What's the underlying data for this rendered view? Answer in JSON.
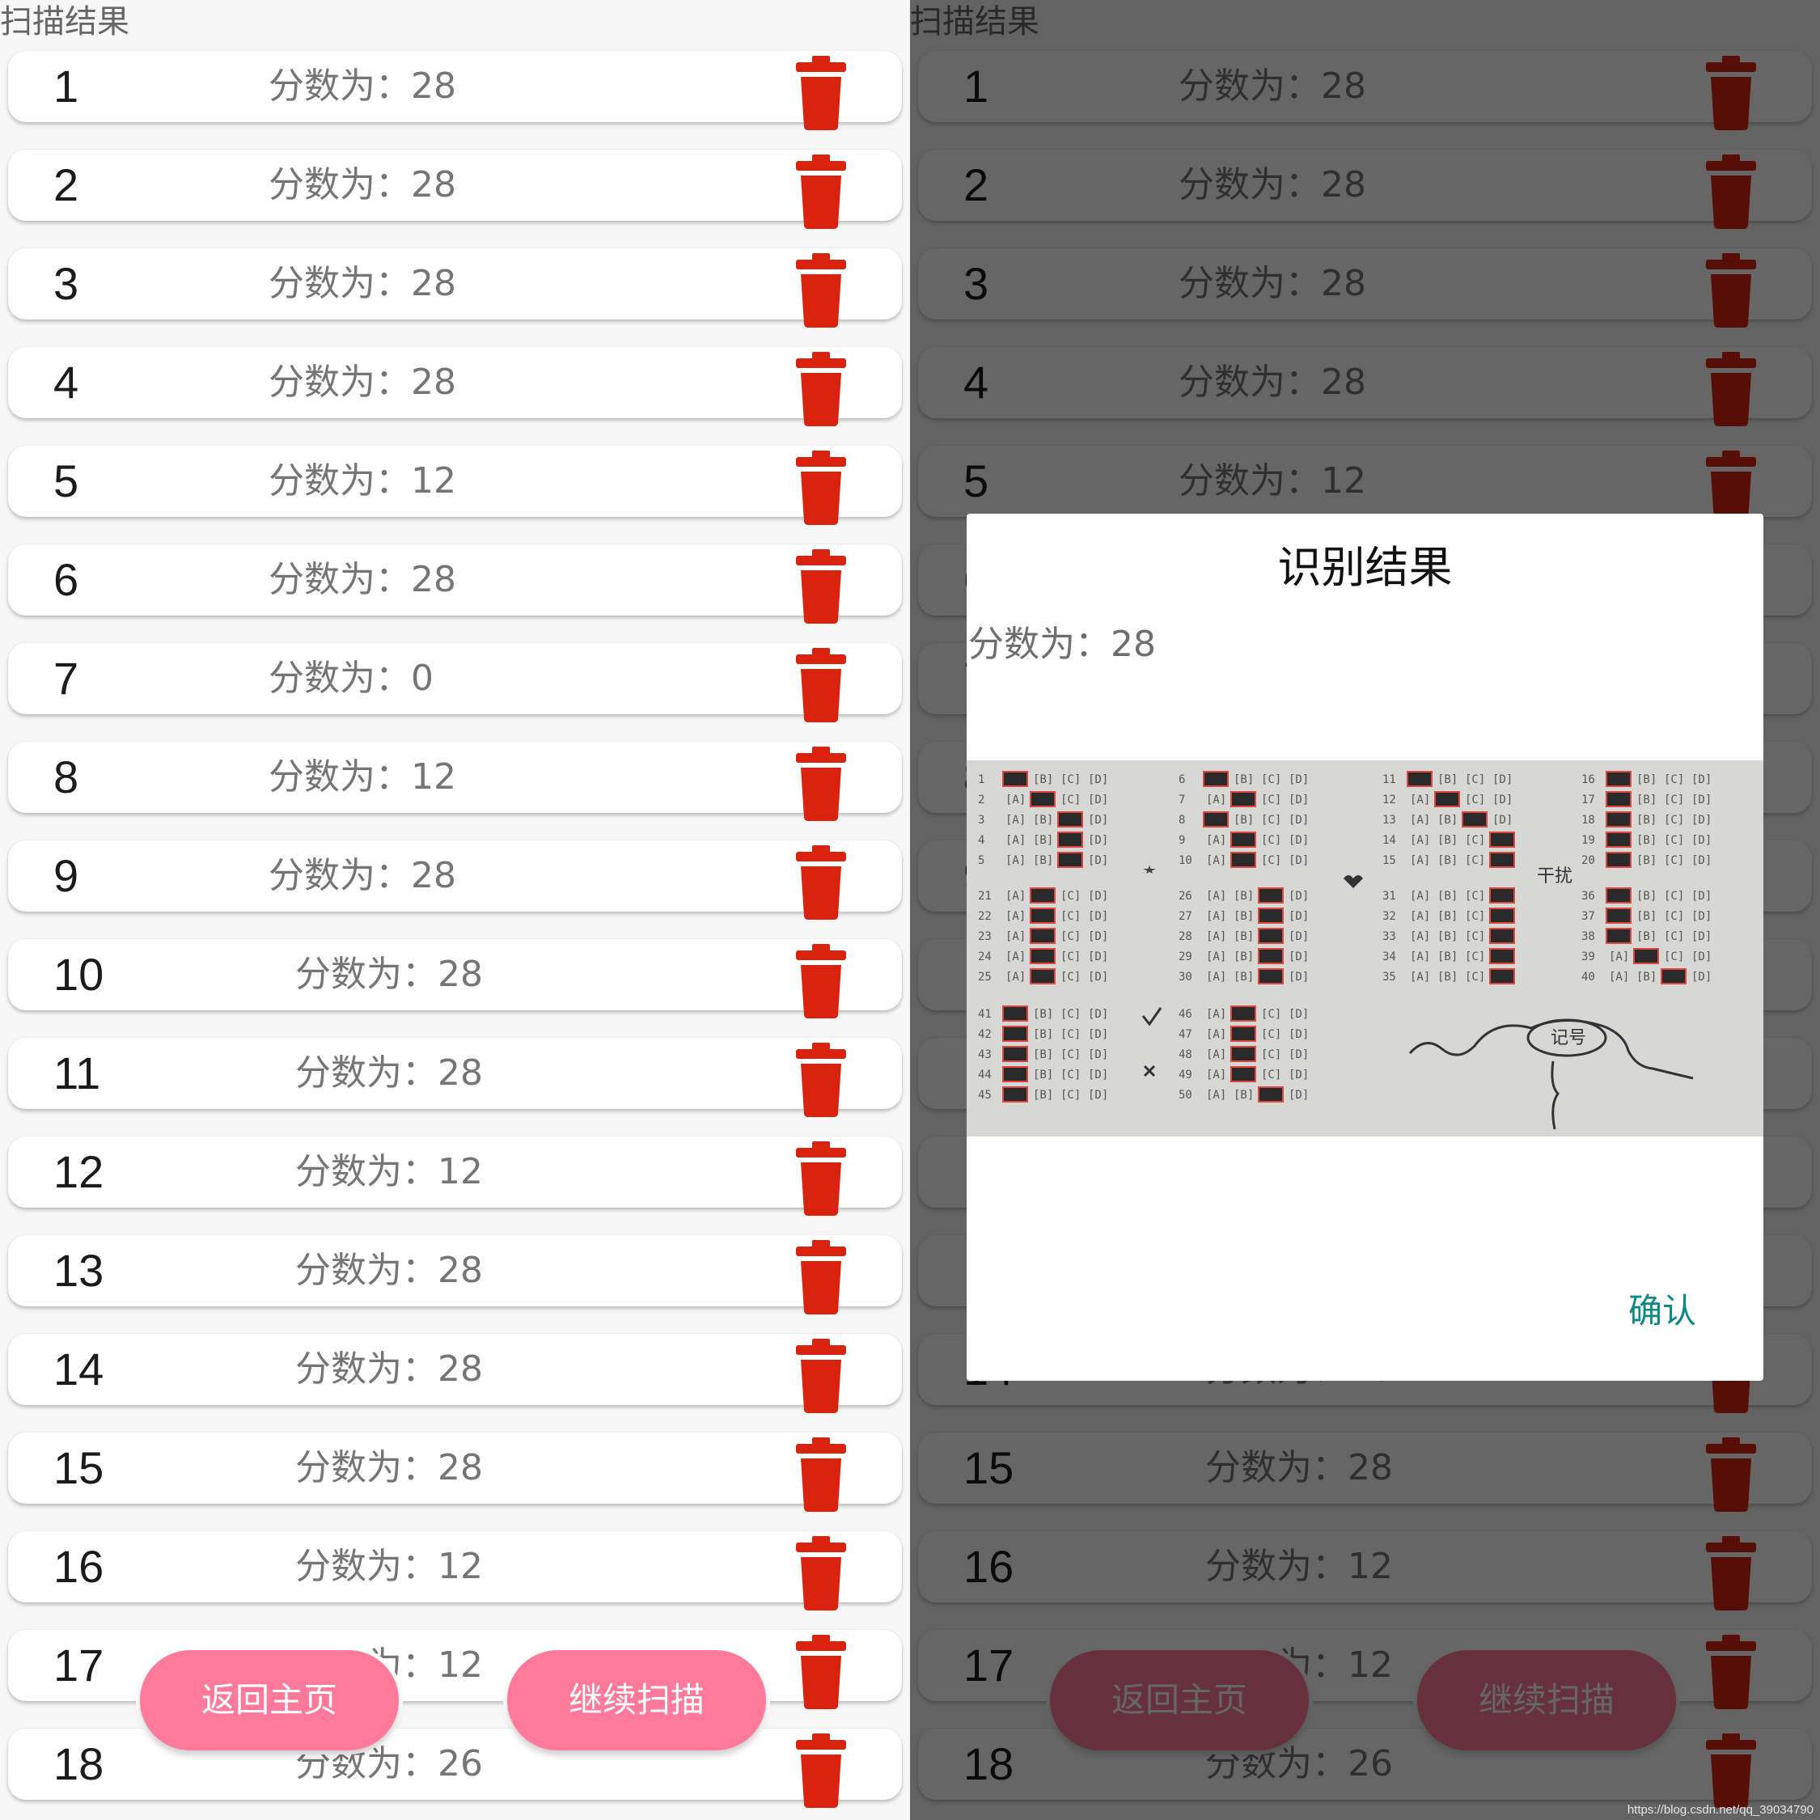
{
  "screen": {
    "title": "扫描结果",
    "score_prefix": "分数为："
  },
  "rows": [
    {
      "number": "1",
      "score": "28"
    },
    {
      "number": "2",
      "score": "28"
    },
    {
      "number": "3",
      "score": "28"
    },
    {
      "number": "4",
      "score": "28"
    },
    {
      "number": "5",
      "score": "12"
    },
    {
      "number": "6",
      "score": "28"
    },
    {
      "number": "7",
      "score": "0"
    },
    {
      "number": "8",
      "score": "12"
    },
    {
      "number": "9",
      "score": "28"
    },
    {
      "number": "10",
      "score": "28"
    },
    {
      "number": "11",
      "score": "28"
    },
    {
      "number": "12",
      "score": "12"
    },
    {
      "number": "13",
      "score": "28"
    },
    {
      "number": "14",
      "score": "28"
    },
    {
      "number": "15",
      "score": "28"
    },
    {
      "number": "16",
      "score": "12"
    },
    {
      "number": "17",
      "score": "12"
    },
    {
      "number": "18",
      "score": "26"
    }
  ],
  "buttons": {
    "back_home": "返回主页",
    "continue_scan": "继续扫描"
  },
  "dialog": {
    "title": "识别结果",
    "message": "分数为：28",
    "confirm": "确认"
  },
  "answer_sheet": {
    "options": [
      "A",
      "B",
      "C",
      "D"
    ],
    "blocks": [
      {
        "start": 1,
        "marked": [
          0,
          1,
          2,
          2,
          2
        ]
      },
      {
        "start": 6,
        "marked": [
          0,
          1,
          0,
          1,
          1
        ]
      },
      {
        "start": 11,
        "marked": [
          0,
          1,
          2,
          3,
          3
        ]
      },
      {
        "start": 16,
        "marked": [
          0,
          0,
          0,
          0,
          0
        ]
      },
      {
        "start": 21,
        "marked": [
          1,
          1,
          1,
          1,
          1
        ]
      },
      {
        "start": 26,
        "marked": [
          2,
          2,
          2,
          2,
          2
        ]
      },
      {
        "start": 31,
        "marked": [
          3,
          3,
          3,
          3,
          3
        ]
      },
      {
        "start": 36,
        "marked": [
          0,
          0,
          0,
          1,
          2
        ]
      },
      {
        "start": 41,
        "marked": [
          0,
          0,
          0,
          0,
          0
        ]
      },
      {
        "start": 46,
        "marked": [
          1,
          1,
          1,
          1,
          2
        ]
      }
    ],
    "annotations": [
      "干扰",
      "记号"
    ]
  },
  "watermark": "https://blog.csdn.net/qq_39034790",
  "colors": {
    "trash": "#d9230f",
    "fab": "#ff7a9a",
    "confirm": "#0d8a86"
  }
}
